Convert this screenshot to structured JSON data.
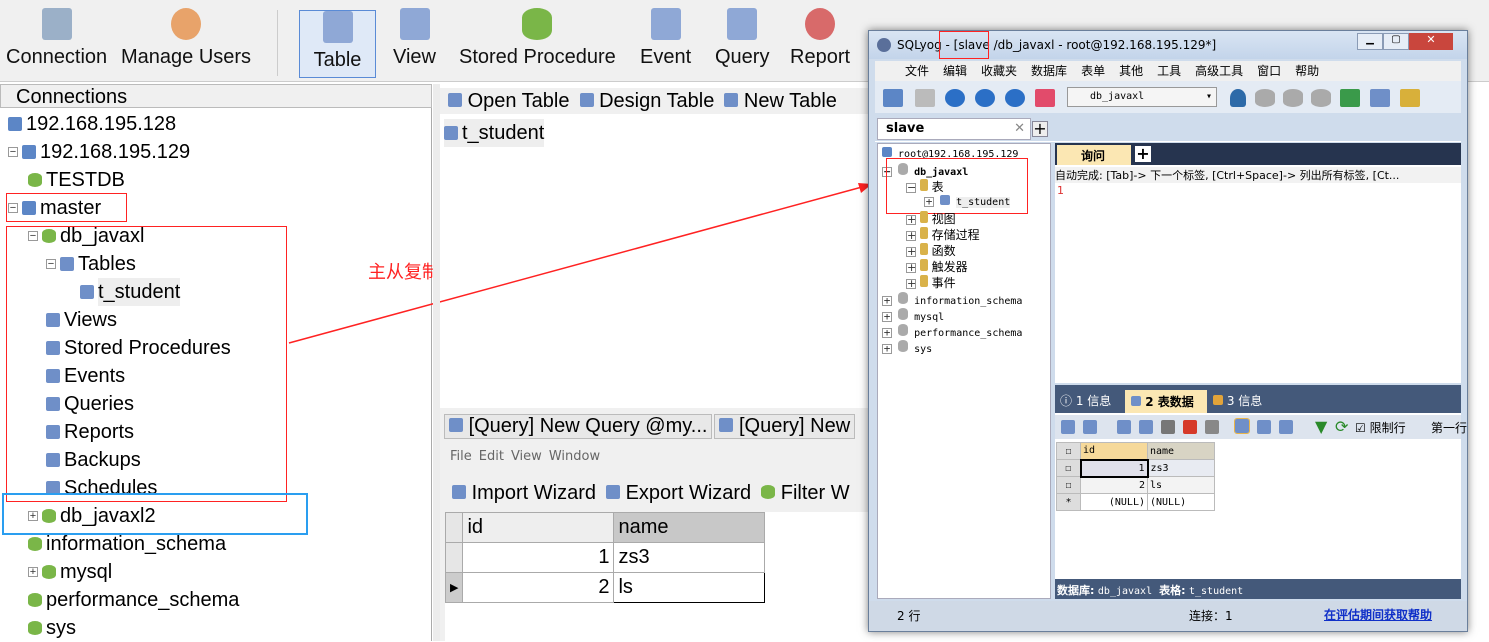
{
  "toolbar": {
    "items": [
      "Connection",
      "Manage Users",
      "Table",
      "View",
      "Stored Procedure",
      "Event",
      "Query",
      "Report"
    ],
    "active": "Table"
  },
  "connections": {
    "header": "Connections",
    "tree": [
      {
        "label": "192.168.195.128",
        "icon": "server-icon"
      },
      {
        "label": "192.168.195.129",
        "icon": "server-icon"
      },
      {
        "label": "TESTDB",
        "icon": "database-icon"
      },
      {
        "label": "master",
        "icon": "server-icon"
      },
      {
        "label": "db_javaxl",
        "icon": "database-icon"
      },
      {
        "label": "Tables",
        "icon": "table-icon"
      },
      {
        "label": "t_student",
        "icon": "table-icon"
      },
      {
        "label": "Views",
        "icon": "view-icon"
      },
      {
        "label": "Stored Procedures",
        "icon": "procedure-icon"
      },
      {
        "label": "Events",
        "icon": "event-icon"
      },
      {
        "label": "Queries",
        "icon": "query-icon"
      },
      {
        "label": "Reports",
        "icon": "report-icon"
      },
      {
        "label": "Backups",
        "icon": "backup-icon"
      },
      {
        "label": "Schedules",
        "icon": "schedule-icon"
      },
      {
        "label": "db_javaxl2",
        "icon": "database-icon"
      },
      {
        "label": "information_schema",
        "icon": "database-icon"
      },
      {
        "label": "mysql",
        "icon": "database-icon"
      },
      {
        "label": "performance_schema",
        "icon": "database-icon"
      },
      {
        "label": "sys",
        "icon": "database-icon"
      }
    ]
  },
  "objbar": {
    "open": "Open Table",
    "design": "Design Table",
    "new": "New Table",
    "object": "t_student"
  },
  "query": {
    "tabs": [
      "[Query] New Query @my...",
      "[Query] New"
    ],
    "menu": [
      "File",
      "Edit",
      "View",
      "Window"
    ],
    "import": "Import Wizard",
    "export": "Export Wizard",
    "filter": "Filter W",
    "columns": [
      "id",
      "name"
    ],
    "rows": [
      [
        "1",
        "zs3"
      ],
      [
        "2",
        "ls"
      ]
    ]
  },
  "annotation": {
    "text": "主从复制",
    "color": "#ff2222"
  },
  "sqlyog": {
    "title": "SQLyog - [slave /db_javaxl - root@192.168.195.129*]",
    "menu": [
      "文件",
      "编辑",
      "收藏夹",
      "数据库",
      "表单",
      "其他",
      "工具",
      "高级工具",
      "窗口",
      "帮助"
    ],
    "db_select": "db_javaxl",
    "tab": "slave",
    "tree": {
      "root": "root@192.168.195.129",
      "db": "db_javaxl",
      "tables": "表",
      "table": "t_student",
      "folders": [
        "视图",
        "存储过程",
        "函数",
        "触发器",
        "事件"
      ],
      "others": [
        "information_schema",
        "mysql",
        "performance_schema",
        "sys"
      ]
    },
    "query_tab": "询问",
    "autocomplete": "自动完成: [Tab]-> 下一个标签, [Ctrl+Space]-> 列出所有标签, [Ct...",
    "line": "1",
    "result_tabs": [
      "1 信息",
      "2 表数据",
      "3 信息"
    ],
    "limit": "限制行",
    "first": "第一行",
    "columns": [
      "id",
      "name"
    ],
    "rows": [
      [
        "1",
        "zs3"
      ],
      [
        "2",
        "ls"
      ],
      [
        "(NULL)",
        "(NULL)"
      ]
    ],
    "status_db_label": "数据库:",
    "status_db": "db_javaxl",
    "status_tbl_label": "表格:",
    "status_tbl": "t_student",
    "rows_count": "2 行",
    "conn": "连接：1",
    "help": "在评估期间获取帮助"
  }
}
